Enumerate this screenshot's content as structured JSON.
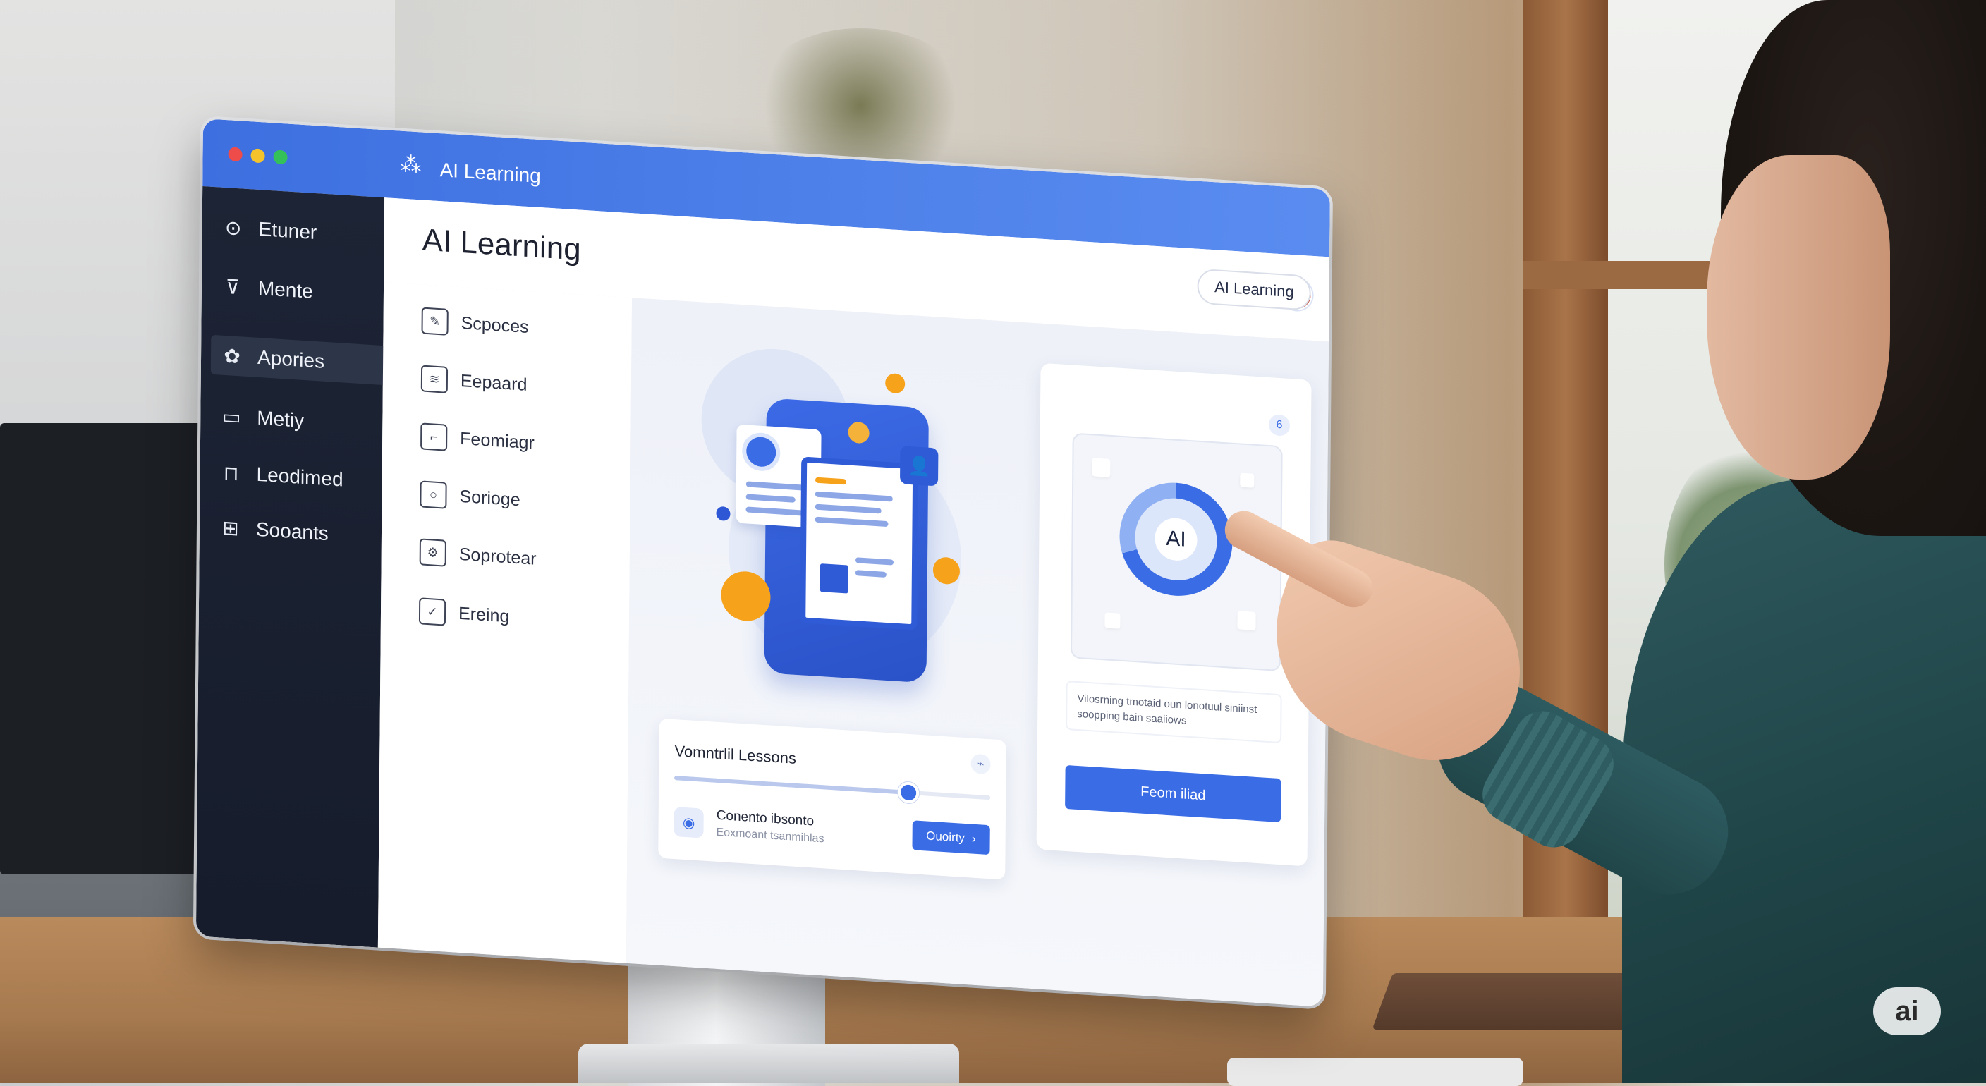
{
  "window": {
    "title": "AI Learning"
  },
  "sidebar": {
    "items": [
      {
        "label": "Etuner",
        "icon": "circle-dot-icon"
      },
      {
        "label": "Mente",
        "icon": "dropdown-circle-icon"
      },
      {
        "label": "Apories",
        "icon": "puzzle-icon",
        "active": true
      },
      {
        "label": "Metiy",
        "icon": "chat-icon"
      },
      {
        "label": "Leodimed",
        "icon": "lock-icon"
      },
      {
        "label": "Sooants",
        "icon": "gift-icon"
      }
    ]
  },
  "header": {
    "title": "AI Learning",
    "chip_label": "AI Learning"
  },
  "subnav": {
    "items": [
      {
        "label": "Scpoces",
        "icon": "pencil-doc-icon"
      },
      {
        "label": "Eepaard",
        "icon": "clipboard-icon"
      },
      {
        "label": "Feomiagr",
        "icon": "doc-icon"
      },
      {
        "label": "Sorioge",
        "icon": "square-icon"
      },
      {
        "label": "Soprotear",
        "icon": "gear-square-icon"
      },
      {
        "label": "Ereing",
        "icon": "checkbox-icon"
      }
    ]
  },
  "lessons": {
    "title": "Vomntrlil Lessons",
    "progress": 0.74,
    "row_title": "Conento ibsonto",
    "row_subtitle": "Eoxmoant tsanmihlas",
    "button_label": "Ouoirty"
  },
  "ai_panel": {
    "badge": "6",
    "core_label": "AI",
    "description": "Vilosrning tmotaid oun lonotuul siniinst soopping bain saaiiows",
    "cta_label": "Feom iliad"
  },
  "watermark": "ai",
  "colors": {
    "accent": "#3a6ce6",
    "titlebar": "#4f82ea",
    "sidebar": "#1d2435"
  }
}
